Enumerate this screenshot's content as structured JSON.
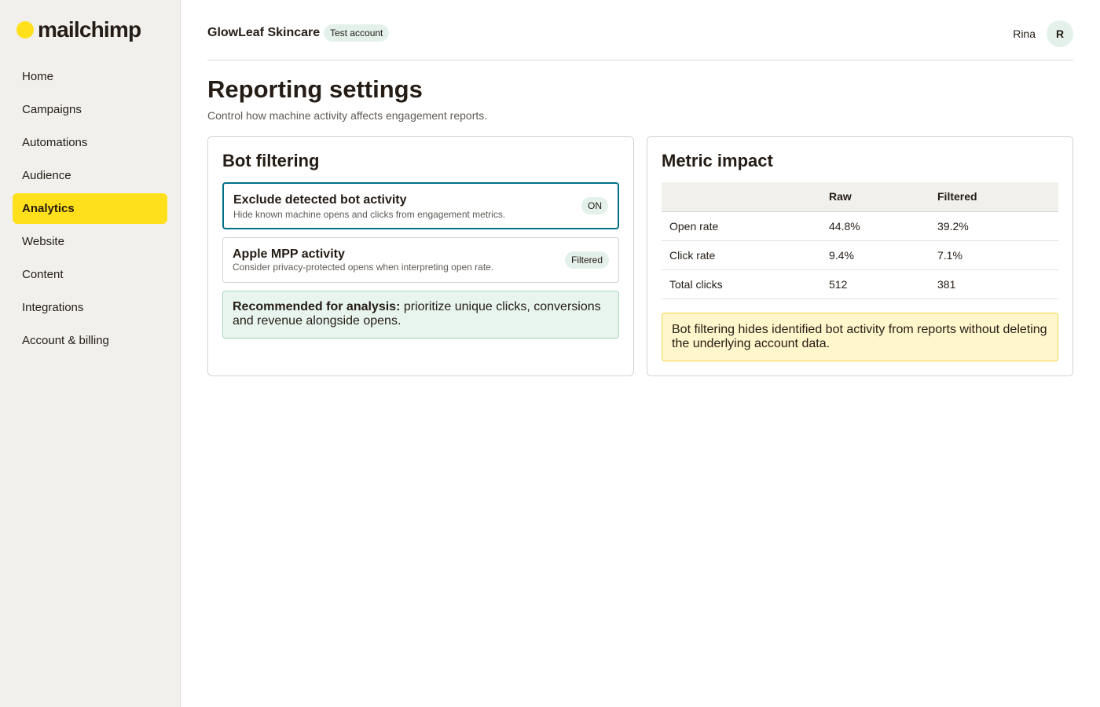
{
  "brand": {
    "name": "mailchimp",
    "accent": "#ffe01b"
  },
  "sidebar": {
    "items": [
      {
        "label": "Home",
        "active": false
      },
      {
        "label": "Campaigns",
        "active": false
      },
      {
        "label": "Automations",
        "active": false
      },
      {
        "label": "Audience",
        "active": false
      },
      {
        "label": "Analytics",
        "active": true
      },
      {
        "label": "Website",
        "active": false
      },
      {
        "label": "Content",
        "active": false
      },
      {
        "label": "Integrations",
        "active": false
      },
      {
        "label": "Account & billing",
        "active": false
      }
    ]
  },
  "header": {
    "account_name": "GlowLeaf Skincare",
    "account_badge": "Test account",
    "user_name": "Rina",
    "avatar_initial": "R"
  },
  "page": {
    "title": "Reporting settings",
    "subtitle": "Control how machine activity affects engagement reports."
  },
  "bot_filtering": {
    "title": "Bot filtering",
    "options": [
      {
        "title": "Exclude detected bot activity",
        "description": "Hide known machine opens and clicks from engagement metrics.",
        "badge": "ON",
        "selected": true
      },
      {
        "title": "Apple MPP activity",
        "description": "Consider privacy-protected opens when interpreting open rate.",
        "badge": "Filtered",
        "selected": false
      }
    ],
    "recommendation": {
      "label": "Recommended for analysis:",
      "text": " prioritize unique clicks, conversions and revenue alongside opens."
    }
  },
  "metric_impact": {
    "title": "Metric impact",
    "columns": [
      "",
      "Raw",
      "Filtered"
    ],
    "rows": [
      {
        "metric": "Open rate",
        "raw": "44.8%",
        "filtered": "39.2%"
      },
      {
        "metric": "Click rate",
        "raw": "9.4%",
        "filtered": "7.1%"
      },
      {
        "metric": "Total clicks",
        "raw": "512",
        "filtered": "381"
      }
    ],
    "notice": "Bot filtering hides identified bot activity from reports without deleting the underlying account data."
  }
}
